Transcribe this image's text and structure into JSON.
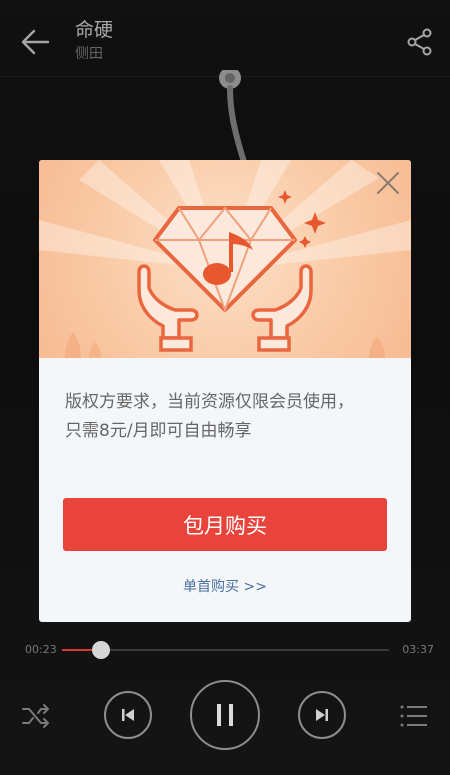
{
  "header": {
    "song_title": "命硬",
    "artist": "侧田"
  },
  "modal": {
    "message_line1": "版权方要求，当前资源仅限会员使用，",
    "message_line2": "只需8元/月即可自由畅享",
    "primary_button": "包月购买",
    "secondary_link": "单首购买 >>"
  },
  "player": {
    "current_time": "00:23",
    "total_time": "03:37",
    "progress_fraction": 0.12
  },
  "colors": {
    "accent": "#e8443b",
    "link": "#4a6fa0",
    "banner": "#f9c9a4"
  },
  "icons": [
    "back-arrow-icon",
    "share-icon",
    "close-icon",
    "diamond-music-icon",
    "shuffle-icon",
    "previous-icon",
    "pause-icon",
    "next-icon",
    "playlist-icon"
  ]
}
